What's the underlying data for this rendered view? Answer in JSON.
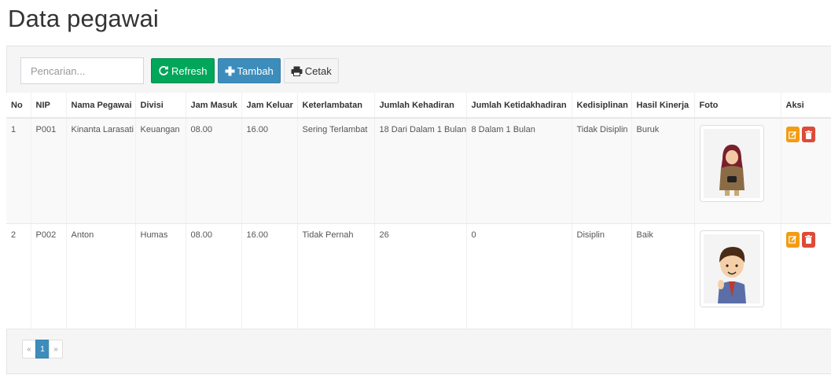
{
  "page": {
    "title": "Data pegawai"
  },
  "toolbar": {
    "search_placeholder": "Pencarian...",
    "refresh_label": "Refresh",
    "add_label": "Tambah",
    "print_label": "Cetak"
  },
  "colors": {
    "refresh": "#00a65a",
    "add": "#3c8dbc",
    "edit": "#f39c12",
    "delete": "#dd4b39",
    "active_page": "#3c8dbc"
  },
  "table": {
    "columns": [
      "No",
      "NIP",
      "Nama Pegawai",
      "Divisi",
      "Jam Masuk",
      "Jam Keluar",
      "Keterlambatan",
      "Jumlah Kehadiran",
      "Jumlah Ketidakhadiran",
      "Kedisiplinan",
      "Hasil Kinerja",
      "Foto",
      "Aksi"
    ],
    "rows": [
      {
        "no": "1",
        "nip": "P001",
        "nama": "Kinanta Larasati",
        "divisi": "Keuangan",
        "jam_masuk": "08.00",
        "jam_keluar": "16.00",
        "keterlambatan": "Sering Terlambat",
        "kehadiran": "18 Dari Dalam 1 Bulan",
        "ketidakhadiran": "8 Dalam 1 Bulan",
        "kedisiplinan": "Tidak Disiplin",
        "kinerja": "Buruk",
        "foto_icon": "woman-hijab-avatar-icon"
      },
      {
        "no": "2",
        "nip": "P002",
        "nama": "Anton",
        "divisi": "Humas",
        "jam_masuk": "08.00",
        "jam_keluar": "16.00",
        "keterlambatan": "Tidak Pernah",
        "kehadiran": "26",
        "ketidakhadiran": "0",
        "kedisiplinan": "Disiplin",
        "kinerja": "Baik",
        "foto_icon": "man-avatar-icon"
      }
    ]
  },
  "pagination": {
    "prev": "«",
    "current": "1",
    "next": "»"
  }
}
